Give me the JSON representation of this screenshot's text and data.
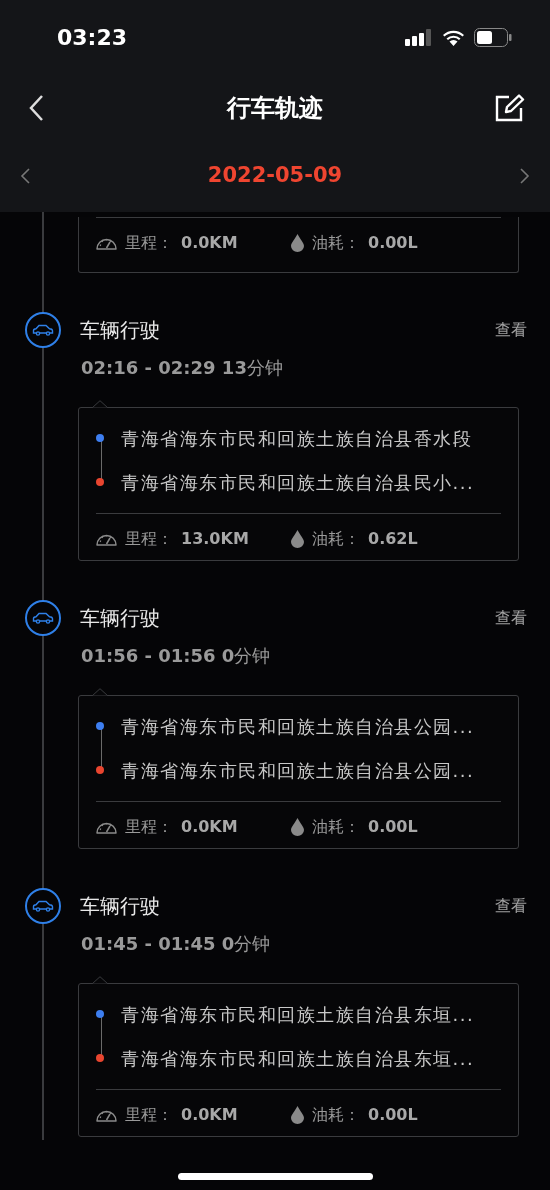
{
  "status_bar": {
    "time": "03:23"
  },
  "nav": {
    "title": "行车轨迹"
  },
  "date_bar": {
    "date": "2022-05-09"
  },
  "trips": [
    {
      "kind": "partial",
      "mileage_label": "里程：",
      "mileage": "0.0KM",
      "fuel_label": "油耗：",
      "fuel": "0.00L"
    },
    {
      "kind": "full",
      "title": "车辆行驶",
      "action": "查看",
      "time": "**02:16 - 02:29 13**分钟",
      "start": "青海省海东市民和回族土族自治县香水段",
      "end": "青海省海东市民和回族土族自治县民小...",
      "mileage_label": "里程：",
      "mileage": "13.0KM",
      "fuel_label": "油耗：",
      "fuel": "0.62L"
    },
    {
      "kind": "full",
      "title": "车辆行驶",
      "action": "查看",
      "time": "**01:56 - 01:56 0**分钟",
      "start": "青海省海东市民和回族土族自治县公园...",
      "end": "青海省海东市民和回族土族自治县公园...",
      "mileage_label": "里程：",
      "mileage": "0.0KM",
      "fuel_label": "油耗：",
      "fuel": "0.00L"
    },
    {
      "kind": "full",
      "title": "车辆行驶",
      "action": "查看",
      "time": "**01:45 - 01:45 0**分钟",
      "start": "青海省海东市民和回族土族自治县东垣...",
      "end": "青海省海东市民和回族土族自治县东垣...",
      "mileage_label": "里程：",
      "mileage": "0.0KM",
      "fuel_label": "油耗：",
      "fuel": "0.00L"
    }
  ]
}
